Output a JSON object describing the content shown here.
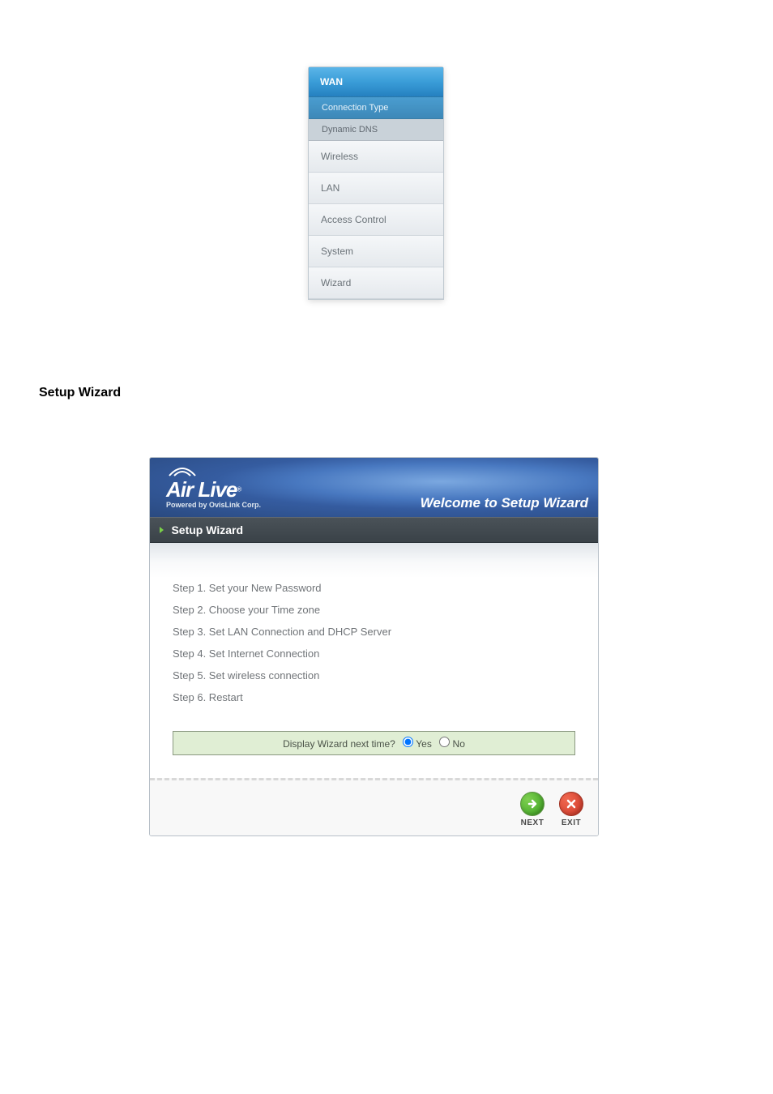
{
  "nav": {
    "wan": {
      "label": "WAN",
      "connection_type": "Connection Type",
      "dynamic_dns": "Dynamic DNS"
    },
    "items": [
      {
        "label": "Wireless"
      },
      {
        "label": "LAN"
      },
      {
        "label": "Access Control"
      },
      {
        "label": "System"
      },
      {
        "label": "Wizard"
      }
    ]
  },
  "section_title": "Setup Wizard",
  "wizard": {
    "logo_main": "Air Live",
    "logo_tag": "Powered by OvisLink Corp.",
    "welcome_title": "Welcome to Setup Wizard",
    "subheader": "Setup Wizard",
    "steps": [
      "Step 1. Set your New Password",
      "Step 2. Choose your Time zone",
      "Step 3. Set LAN Connection and DHCP Server",
      "Step 4. Set Internet Connection",
      "Step 5. Set wireless connection",
      "Step 6. Restart"
    ],
    "display_next_label": "Display Wizard next time?",
    "yes_label": "Yes",
    "no_label": "No",
    "next_btn": "NEXT",
    "exit_btn": "EXIT"
  }
}
